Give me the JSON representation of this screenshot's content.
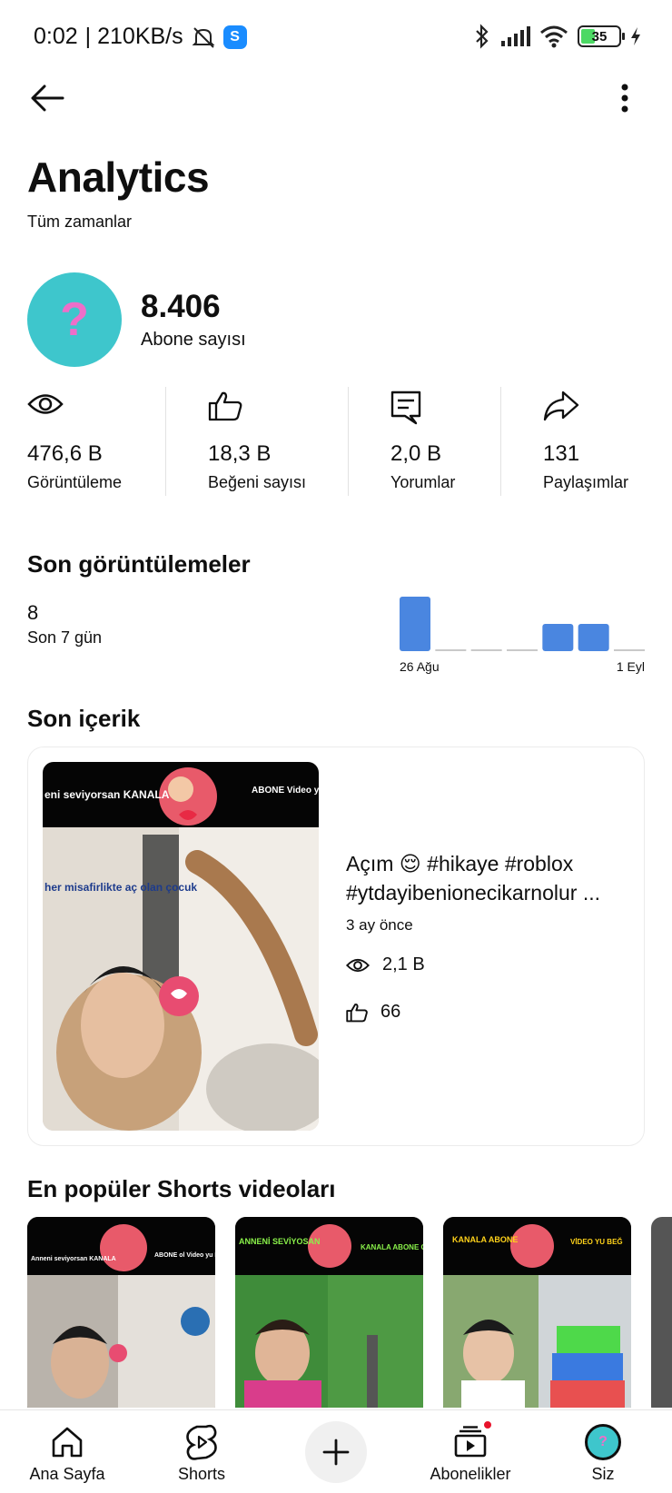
{
  "status_bar": {
    "time": "0:02",
    "net_speed": "| 210KB/s",
    "battery": "35",
    "icons": [
      "mute-icon",
      "shazam-icon",
      "bluetooth-icon",
      "signal-icon",
      "wifi-icon",
      "battery-icon",
      "charging-icon"
    ]
  },
  "header": {
    "title": "Analytics",
    "period": "Tüm zamanlar"
  },
  "subscribers": {
    "count": "8.406",
    "label": "Abone sayısı",
    "avatar_glyph": "?"
  },
  "stats": [
    {
      "value": "476,6 B",
      "label": "Görüntüleme",
      "icon": "eye-icon"
    },
    {
      "value": "18,3 B",
      "label": "Beğeni sayısı",
      "icon": "thumbs-up-icon"
    },
    {
      "value": "2,0 B",
      "label": "Yorumlar",
      "icon": "comment-icon"
    },
    {
      "value": "131",
      "label": "Paylaşımlar",
      "icon": "share-icon"
    }
  ],
  "recent_views": {
    "title": "Son görüntülemeler",
    "count": "8",
    "period": "Son 7 gün"
  },
  "chart_data": {
    "type": "bar",
    "categories": [
      "26 Ağu",
      "",
      "",
      "",
      "",
      "",
      "1 Eyl"
    ],
    "values": [
      4,
      0,
      0,
      0,
      2,
      2,
      0
    ],
    "title": "",
    "xlabel": "",
    "ylabel": "",
    "bar_color": "#4a86e0",
    "zero_color": "#c9c9c9",
    "grid": false
  },
  "recent_content": {
    "section_title": "Son içerik",
    "title": "Açım 😌 #hikaye #roblox #ytdayibenionecikarnolur ...",
    "time": "3 ay önce",
    "views": "2,1 B",
    "likes": "66",
    "thumb_texts": [
      "eni seviyorsan KANALA",
      "ABONE Video yu B",
      "her misafirlikte aç olan çocuk"
    ]
  },
  "popular_shorts": {
    "title": "En popüler Shorts videoları",
    "items": [
      {
        "caption_left": "Anneni seviyorsan KANALA",
        "caption_right": "ABONE ol Video yu BEĞEN",
        "bg": "#b8b2aa"
      },
      {
        "caption_left": "ANNENİ SEVİYOSAN",
        "caption_right": "KANALA ABONE OL",
        "bg": "#3f8c3a"
      },
      {
        "caption_left": "KANALA ABONE",
        "caption_right": "VİDEO YU BEĞ",
        "bg": "#88a870"
      }
    ]
  },
  "bottom_nav": {
    "items": [
      {
        "label": "Ana Sayfa",
        "icon": "home-icon"
      },
      {
        "label": "Shorts",
        "icon": "shorts-icon"
      },
      {
        "label": "",
        "icon": "plus-icon"
      },
      {
        "label": "Abonelikler",
        "icon": "subscriptions-icon"
      },
      {
        "label": "Siz",
        "icon": "avatar"
      }
    ]
  },
  "colors": {
    "accent_blue": "#4a86e0",
    "avatar_bg": "#3ec6cc",
    "avatar_glyph": "#ee6ec9",
    "notification_red": "#e8122b"
  }
}
